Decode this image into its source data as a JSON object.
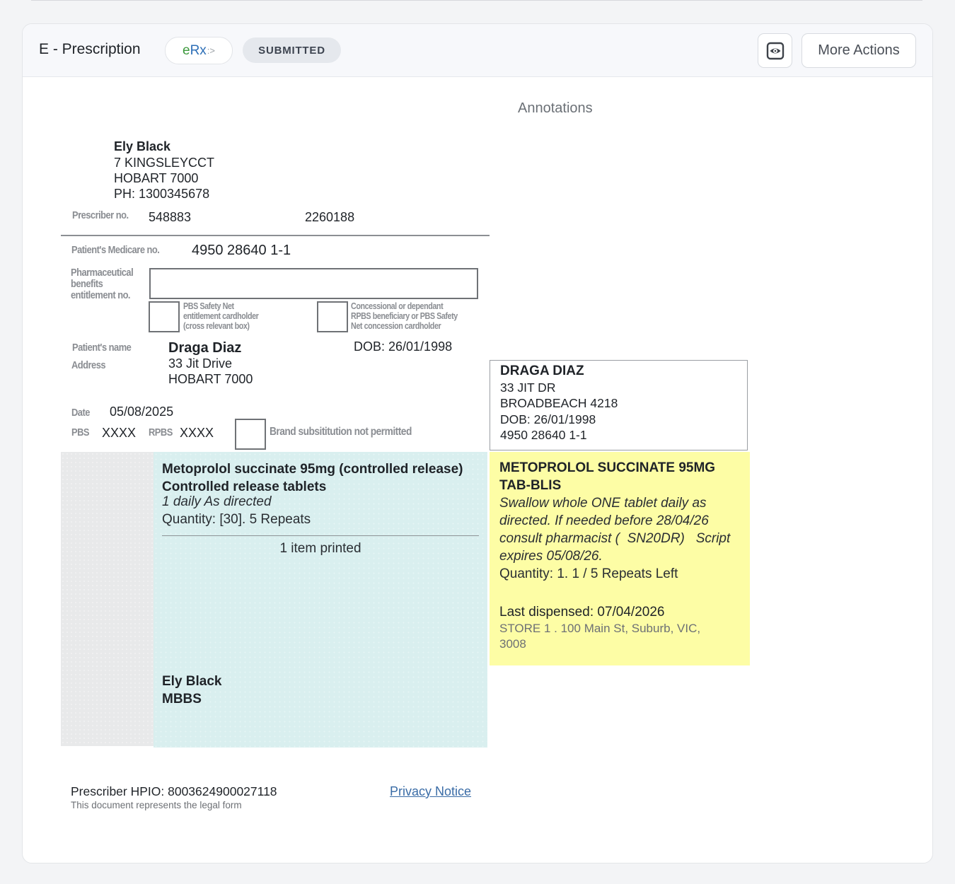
{
  "header": {
    "title": "E - Prescription",
    "erx": {
      "e": "e",
      "rx": "Rx",
      "tail": ":>"
    },
    "status": "SUBMITTED",
    "more_actions_label": "More Actions"
  },
  "annotations_title": "Annotations",
  "prescriber": {
    "name": "Ely Black",
    "address_line1": "7 KINGSLEYCCT",
    "address_line2": "HOBART 7000",
    "phone": "PH: 1300345678",
    "prescriber_no_label": "Prescriber no.",
    "prescriber_no": "548883",
    "second_no": "2260188"
  },
  "form": {
    "medicare_label": "Patient's Medicare no.",
    "medicare_no": "4950 28640 1-1",
    "pharma_label_1": "Pharmaceutical",
    "pharma_label_2": "benefits",
    "pharma_label_3": "entitlement no.",
    "safety_net_1": "PBS Safety Net",
    "safety_net_2": "entitlement cardholder",
    "safety_net_3": "(cross relevant box)",
    "concession_1": "Concessional or dependant",
    "concession_2": "RPBS beneficiary or PBS Safety",
    "concession_3": "Net concession cardholder",
    "patient_name_label": "Patient's name",
    "patient_name": "Draga Diaz",
    "dob": "DOB: 26/01/1998",
    "address_label": "Address",
    "address_line1": "33 Jit Drive",
    "address_line2": "HOBART 7000",
    "date_label": "Date",
    "date": "05/08/2025",
    "pbs_label": "PBS",
    "pbs_value": "XXXX",
    "rpbs_label": "RPBS",
    "rpbs_value": "XXXX",
    "brand_sub_label": "Brand subsititution not permitted"
  },
  "medication": {
    "name": "Metoprolol succinate 95mg (controlled release) Controlled release tablets",
    "directions": "1 daily As directed",
    "quantity": "Quantity: [30]. 5 Repeats",
    "items_printed": "1 item printed",
    "signature_name": "Ely Black",
    "signature_qual": "MBBS"
  },
  "patient_label": {
    "name": "DRAGA DIAZ",
    "address_line1": "33 JIT DR",
    "address_line2": "BROADBEACH 4218",
    "dob": "DOB: 26/01/1998",
    "medicare": "4950 28640 1-1"
  },
  "dispense_label": {
    "drug_line1": "METOPROLOL SUCCINATE 95MG",
    "drug_line2": "TAB-BLIS",
    "dir_line1": "Swallow whole ONE tablet daily as",
    "dir_line2": "directed. If needed before 28/04/26",
    "dir_line3": "consult pharmacist (  SN20DR)   Script",
    "dir_line4": "expires 05/08/26.",
    "quantity": "Quantity: 1. 1 / 5 Repeats Left",
    "last_dispensed": "Last dispensed: 07/04/2026",
    "store_line1": "STORE 1 .  100 Main St, Suburb, VIC,",
    "store_line2": "3008"
  },
  "footer": {
    "hpio": "Prescriber HPIO: 8003624900027118",
    "legal": "This document represents the legal form",
    "privacy_link": "Privacy Notice"
  },
  "icons": {
    "preview": "eye-preview-icon"
  },
  "colors": {
    "dispense_label_bg": "#fdfda5",
    "medication_bg": "#d9efef",
    "link": "#3a6ca6"
  }
}
